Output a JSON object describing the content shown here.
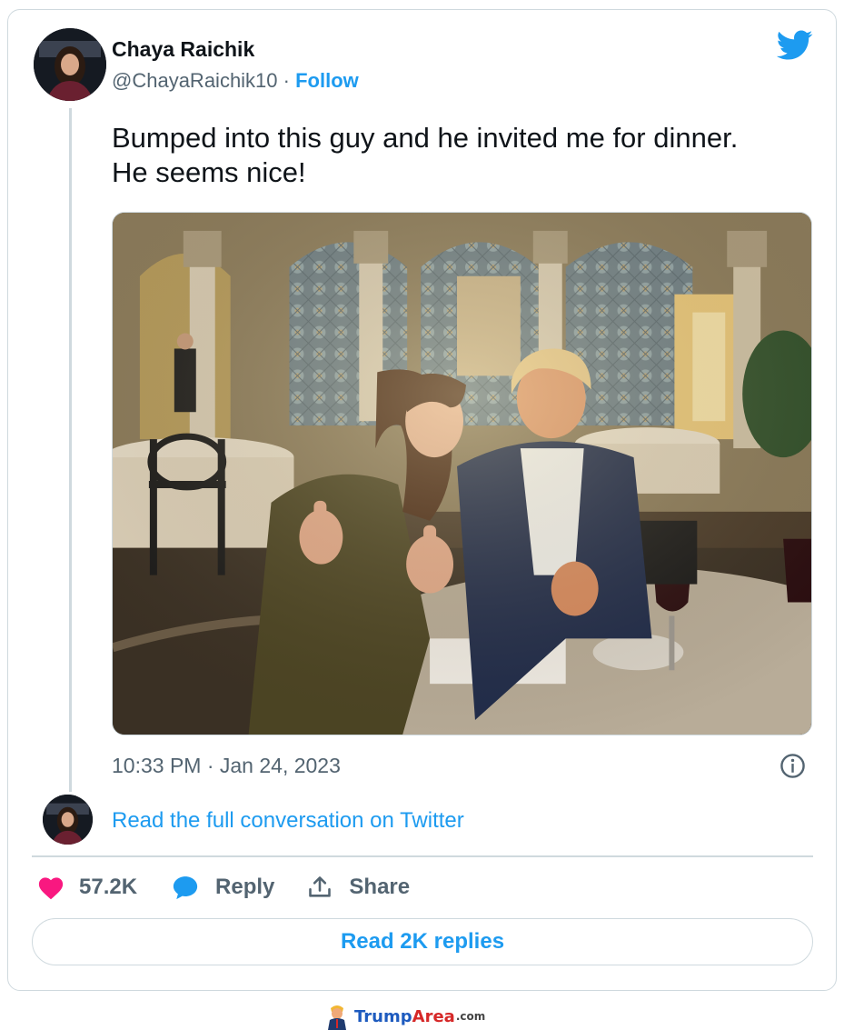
{
  "tweet": {
    "author_name": "Chaya Raichik",
    "handle": "@ChayaRaichik10",
    "separator": " · ",
    "follow_label": "Follow",
    "text_line1": "Bumped into this guy and he invited me for dinner.",
    "text_line2": "He seems nice!",
    "timestamp": "10:33 PM · Jan 24, 2023",
    "read_conversation": "Read the full conversation on Twitter",
    "likes": "57.2K",
    "reply_label": "Reply",
    "share_label": "Share",
    "read_replies": "Read 2K replies"
  },
  "icons": {
    "brand": "twitter-bird-icon",
    "info": "info-icon",
    "like": "heart-icon",
    "reply": "speech-bubble-icon",
    "share": "share-upload-icon"
  },
  "colors": {
    "accent": "#1d9bf0",
    "like": "#f91880",
    "muted": "#536471",
    "border": "#cfd9de"
  },
  "watermark": {
    "part1": "Trump",
    "part2": "Area",
    "tld": ".com"
  }
}
